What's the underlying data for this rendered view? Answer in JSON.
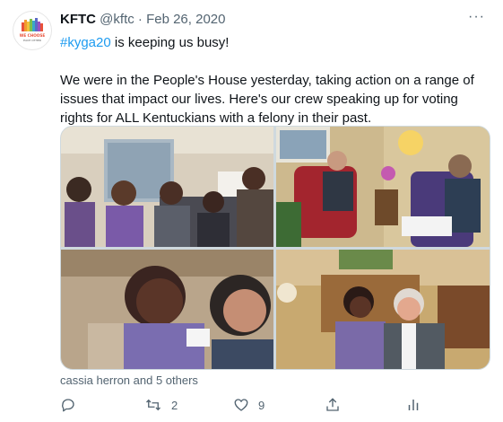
{
  "tweet": {
    "author_name": "KFTC",
    "author_handle": "@kftc",
    "separator": "·",
    "date": "Feb 26, 2020",
    "more_label": "···",
    "hashtag": "#kyga20",
    "line1_rest": " is keeping us busy!",
    "paragraph2": "We were in the People's House yesterday, taking action on a range of issues that impact our lives. Here's our crew speaking up for voting rights for ALL Kentuckians with a felony in their past.",
    "avatar": {
      "line1": "WE CHOOSE",
      "line2": "EACH OTHER"
    },
    "tagged_people": "cassia herron and 5 others",
    "retweet_count": "2",
    "like_count": "9"
  },
  "icons": {
    "reply": "reply-icon",
    "retweet": "retweet-icon",
    "like": "heart-icon",
    "share": "share-icon",
    "analytics": "analytics-icon",
    "more": "more-icon"
  },
  "colors": {
    "accent": "#1d9bf0",
    "text": "#0f1419",
    "muted": "#536471"
  }
}
